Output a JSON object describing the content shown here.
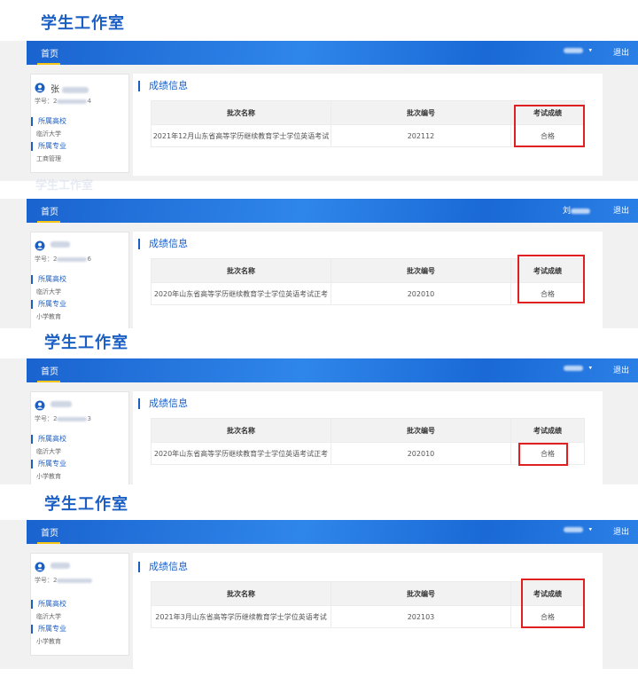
{
  "brand": "学生工作室",
  "nav": {
    "home": "首页",
    "caret": "▾",
    "logout": "退出"
  },
  "labels": {
    "student_id": "学号：",
    "school_section": "所属高校",
    "major_section": "所属专业",
    "grades_title": "成绩信息"
  },
  "table_headers": [
    "批次名称",
    "批次编号",
    "考试成绩"
  ],
  "panels": [
    {
      "user_initial": "张",
      "user_suffix": "",
      "sid_prefix": "2",
      "sid_suffix": "4",
      "school": "临沂大学",
      "major": "工商管理",
      "row": {
        "batch_name": "2021年12月山东省高等学历继续教育学士学位英语考试",
        "batch_no": "202112",
        "result": "合格"
      }
    },
    {
      "user_initial": "",
      "user_suffix": "刘",
      "sid_prefix": "2",
      "sid_suffix": "6",
      "school": "临沂大学",
      "major": "小学教育",
      "row": {
        "batch_name": "2020年山东省高等学历继续教育学士学位英语考试正考",
        "batch_no": "202010",
        "result": "合格"
      }
    },
    {
      "user_initial": "",
      "user_suffix": "",
      "sid_prefix": "2",
      "sid_suffix": "3",
      "school": "临沂大学",
      "major": "小学教育",
      "row": {
        "batch_name": "2020年山东省高等学历继续教育学士学位英语考试正考",
        "batch_no": "202010",
        "result": "合格"
      }
    },
    {
      "user_initial": "",
      "user_suffix": "",
      "sid_prefix": "2",
      "sid_suffix": "",
      "school": "临沂大学",
      "major": "小学教育",
      "row": {
        "batch_name": "2021年3月山东省高等学历继续教育学士学位英语考试",
        "batch_no": "202103",
        "result": "合格"
      }
    }
  ],
  "colors": {
    "brand_blue": "#1b5fc4",
    "highlight_red": "#e02020",
    "underline_yellow": "#f5c518"
  }
}
